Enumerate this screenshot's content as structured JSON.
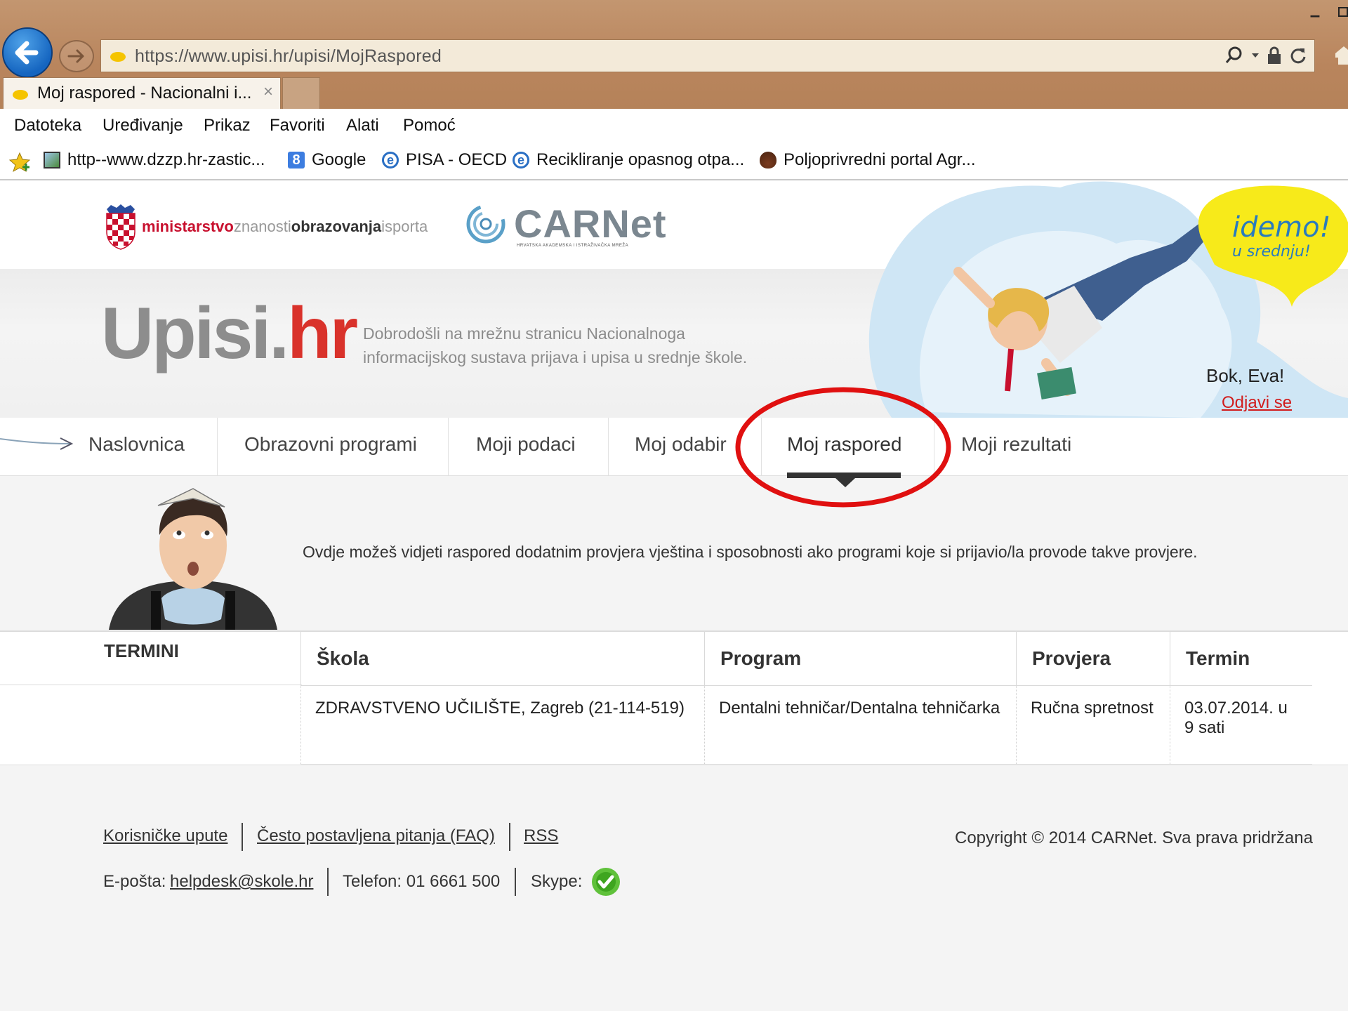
{
  "browser": {
    "url": "https://www.upisi.hr/upisi/MojRaspored",
    "tab_title": "Moj raspored - Nacionalni i...",
    "tab_close": "×",
    "menu": [
      "Datoteka",
      "Uređivanje",
      "Prikaz",
      "Favoriti",
      "Alati",
      "Pomoć"
    ],
    "favorites": [
      {
        "label": "http--www.dzzp.hr-zastic...",
        "icon": "page-icon"
      },
      {
        "label": "Google",
        "icon": "google-icon"
      },
      {
        "label": "PISA - OECD",
        "icon": "ie-icon"
      },
      {
        "label": "Recikliranje opasnog otpa...",
        "icon": "ie-icon"
      },
      {
        "label": "Poljoprivredni portal  Agr...",
        "icon": "acorn-icon"
      }
    ]
  },
  "header": {
    "ministry": {
      "w1": "ministarstvo",
      "w2": "znanosti",
      "w3": "obrazovanja",
      "w4": "isporta"
    },
    "carnet": "CARNet",
    "carnet_sub": "HRVATSKA AKADEMSKA I ISTRAŽIVAČKA MREŽA",
    "logo_main": "Upisi.",
    "logo_accent": "hr",
    "welcome": "Dobrodošli na mrežnu stranicu Nacionalnoga informacijskog sustava prijava i upisa u srednje škole.",
    "badge_line1": "idemo!",
    "badge_line2": "u srednju!",
    "greeting": "Bok, Eva!",
    "logout": "Odjavi se"
  },
  "nav": {
    "items": [
      "Naslovnica",
      "Obrazovni programi",
      "Moji podaci",
      "Moj odabir",
      "Moj raspored",
      "Moji rezultati"
    ],
    "active": "Moj raspored"
  },
  "content": {
    "intro": "Ovdje možeš vidjeti raspored dodatnim provjera vještina i sposobnosti ako programi koje si prijavio/la provode takve provjere.",
    "section_label": "TERMINI",
    "columns": [
      "Škola",
      "Program",
      "Provjera",
      "Termin"
    ],
    "rows": [
      [
        "ZDRAVSTVENO UČILIŠTE, Zagreb (21-114-519)",
        "Dentalni tehničar/Dentalna tehničarka",
        "Ručna spretnost",
        "03.07.2014. u 9 sati"
      ]
    ]
  },
  "footer": {
    "links": [
      "Korisničke upute",
      "Često postavljena pitanja (FAQ)",
      "RSS"
    ],
    "copyright": "Copyright © 2014 CARNet. Sva prava pridržana",
    "email_label": "E-pošta:",
    "email": "helpdesk@skole.hr",
    "phone": "Telefon: 01 6661 500",
    "skype_label": "Skype:"
  },
  "colors": {
    "brand_red": "#d9322b",
    "annotation": "#e01010",
    "chrome": "#b9855d"
  }
}
